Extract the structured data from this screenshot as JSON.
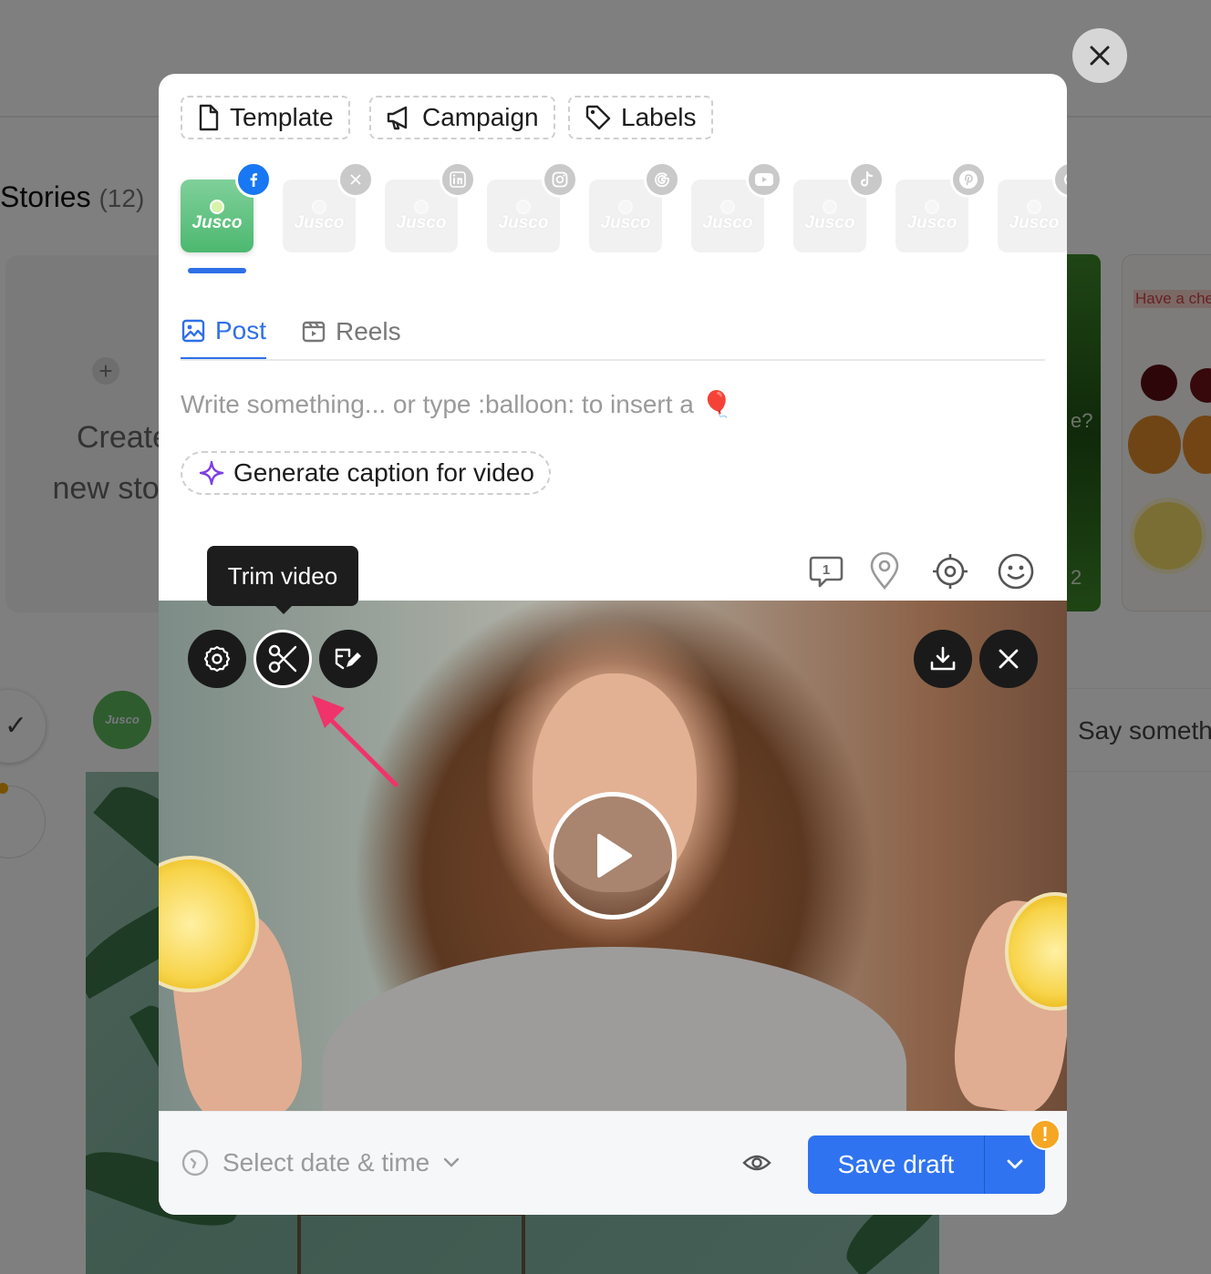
{
  "background": {
    "stories_title": "Stories",
    "stories_count": "(12)",
    "create_card_text": "Create\nnew stor",
    "green_card_text_1": "e?",
    "green_card_text_2": "2",
    "cherry_card_text": "Have a che",
    "reply_placeholder": "Say someth",
    "avatar_brand": "Jusco"
  },
  "modal": {
    "chips": [
      {
        "label": "Template",
        "icon": "file-icon"
      },
      {
        "label": "Campaign",
        "icon": "megaphone-icon"
      },
      {
        "label": "Labels",
        "icon": "tag-icon"
      }
    ],
    "accounts": [
      {
        "brand": "Jusco",
        "network": "facebook",
        "active": true
      },
      {
        "brand": "Jusco",
        "network": "x",
        "active": false
      },
      {
        "brand": "Jusco",
        "network": "linkedin",
        "active": false
      },
      {
        "brand": "Jusco",
        "network": "instagram",
        "active": false
      },
      {
        "brand": "Jusco",
        "network": "google",
        "active": false
      },
      {
        "brand": "Jusco",
        "network": "youtube",
        "active": false
      },
      {
        "brand": "Jusco",
        "network": "tiktok",
        "active": false
      },
      {
        "brand": "Jusco",
        "network": "pinterest",
        "active": false
      },
      {
        "brand": "Jusco",
        "network": "threads",
        "active": false
      }
    ],
    "tabs": [
      {
        "label": "Post",
        "active": true
      },
      {
        "label": "Reels",
        "active": false
      }
    ],
    "composer_placeholder": "Write something... or type :balloon: to insert a 🎈",
    "generate_caption_label": "Generate caption for video",
    "first_comment_count": "1",
    "tooltip": "Trim video",
    "footer": {
      "datetime_placeholder": "Select date & time",
      "save_label": "Save draft",
      "warning_mark": "!"
    }
  },
  "colors": {
    "accent": "#2f73f0",
    "facebook": "#1877f2",
    "brand_green": "#5cbd7d",
    "warning": "#f5a623",
    "sparkle": "#7b3fe4",
    "arrow": "#f0336a"
  }
}
